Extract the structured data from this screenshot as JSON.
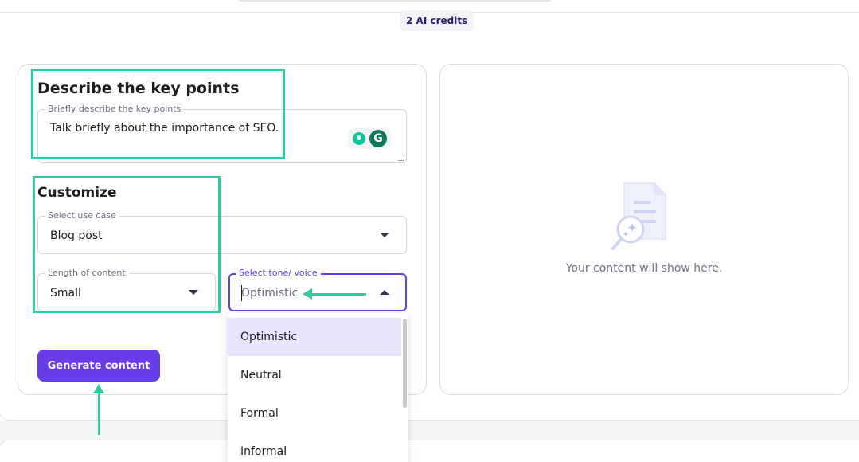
{
  "header": {
    "credits": "2 AI credits"
  },
  "key_points": {
    "title": "Describe the key points",
    "field_label": "Briefly describe the key points",
    "field_value": "Talk briefly about the importance of SEO.",
    "grammarly_letter": "G"
  },
  "customize": {
    "title": "Customize",
    "use_case": {
      "label": "Select use case",
      "value": "Blog post"
    },
    "length": {
      "label": "Length of content",
      "value": "Small"
    },
    "tone": {
      "label": "Select tone/ voice",
      "value": "Optimistic",
      "options": [
        "Optimistic",
        "Neutral",
        "Formal",
        "Informal"
      ],
      "selected": "Optimistic"
    }
  },
  "actions": {
    "generate_label": "Generate content"
  },
  "output": {
    "empty_text": "Your content will show here."
  },
  "colors": {
    "accent": "#673de6",
    "highlight": "#2ecca0",
    "selected_option": "#ebe4ff"
  }
}
